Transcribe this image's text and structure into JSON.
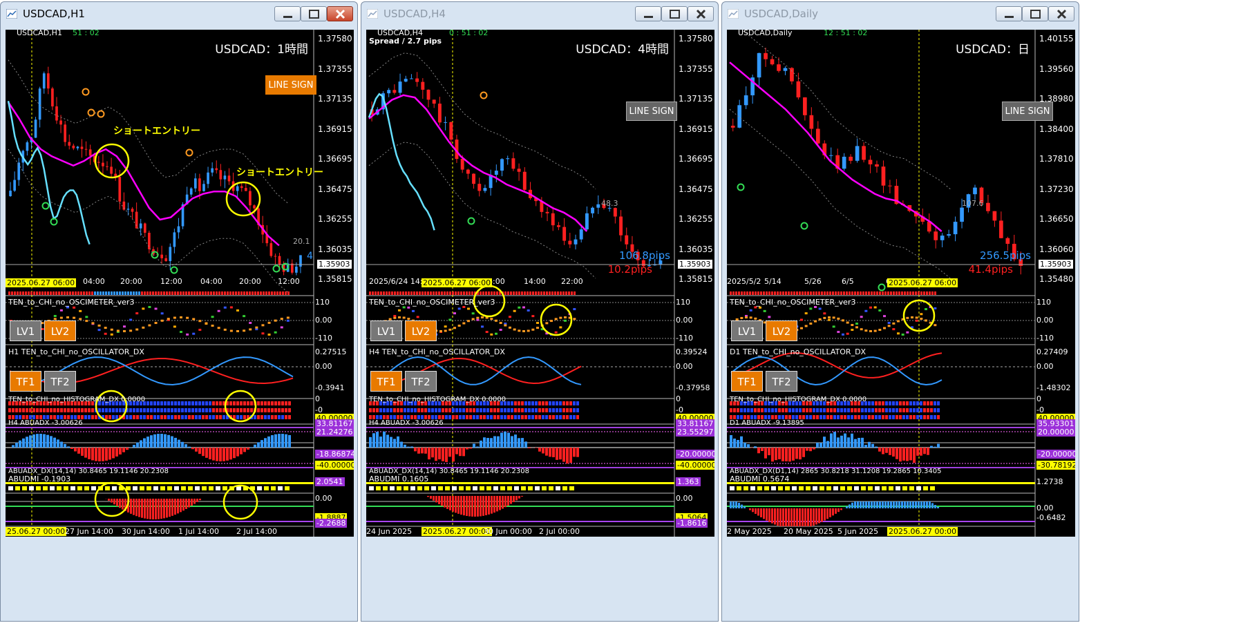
{
  "windows": [
    {
      "title": "USDCAD,H1",
      "symbol_label": "USDCAD,H1",
      "timer": "51 : 02",
      "spread": "",
      "big_title": "USDCAD：1時間",
      "line_sign": "LINE SIGN",
      "prices": [
        "1.37580",
        "1.37355",
        "1.37135",
        "1.36915",
        "1.36695",
        "1.36475",
        "1.36255",
        "1.36035",
        "1.35815"
      ],
      "current_price": "1.35903",
      "time_labels": [
        "04:00",
        "20:00",
        "12:00",
        "04:00",
        "20:00",
        "12:00"
      ],
      "date_marker": "2025.06.27 06:00",
      "annotations": [
        "ショートエントリー",
        "ショートエントリー"
      ],
      "right_value": "20.1",
      "right_value2": "4",
      "pips_up": "",
      "pips_down": "",
      "osc_name": "TEN_to_CHI_no_OSCIMETER_ver3",
      "osc_scale": [
        "110",
        "0.00",
        "-110"
      ],
      "lv1": "LV1",
      "lv2": "LV2",
      "dx_name": "H1 TEN_to_CHI_no_OSCILLATOR_DX",
      "dx_scale": [
        "0.27515",
        "0.00",
        "-0.3941"
      ],
      "tf1": "TF1",
      "tf2": "TF2",
      "hist_name": "TEN_to_CHI_no_HISTOGRAM_DX 0.0000",
      "hist_scale": [
        "0",
        "-0"
      ],
      "abuadx_name": "H4 ABUADX -3.00626",
      "abuadx_boxes": [
        "33.81167",
        "21.24276",
        "-18.86874",
        "-40.00000"
      ],
      "abuadx_top": "40.00000",
      "adx_strip": "ABUADX_DX(14,14) 30.8465 19.1146 20.2308",
      "abudmi_name": "ABUDMI -0.1903",
      "abudmi_boxes": [
        "2.0541",
        "0.00",
        "-1.8887",
        "-2.2688"
      ],
      "bottom_dates": [
        "25.06.27 00:00",
        "27 Jun 14:00",
        "30 Jun 14:00",
        "1 Jul 14:00",
        "2 Jul 14:00"
      ]
    },
    {
      "title": "USDCAD,H4",
      "symbol_label": "USDCAD,H4",
      "timer": "0 : 51 : 02",
      "spread": "Spread / 2.7 pips",
      "big_title": "USDCAD：4時間",
      "line_sign": "LINE SIGN",
      "prices": [
        "1.37580",
        "1.37355",
        "1.37135",
        "1.36915",
        "1.36695",
        "1.36475",
        "1.36255",
        "1.36035",
        "1.35815"
      ],
      "current_price": "1.35903",
      "time_labels": [
        "2025/6/24 14:00",
        "6:00",
        "14:00",
        "22:00"
      ],
      "date_marker": "2025.06.27 06:00",
      "annotations": [],
      "right_value": "48.3",
      "right_value2": "",
      "pips_up": "106.8pips",
      "pips_down": "10.2pips",
      "osc_name": "TEN_to_CHI_no_OSCIMETER_ver3",
      "osc_scale": [
        "110",
        "0.00",
        "-110"
      ],
      "lv1": "LV1",
      "lv2": "LV2",
      "dx_name": "H4 TEN_to_CHI_no_OSCILLATOR_DX",
      "dx_scale": [
        "0.39524",
        "0.00",
        "-0.37958"
      ],
      "tf1": "TF1",
      "tf2": "TF2",
      "hist_name": "TEN_to_CHI_no_HISTOGRAM_DX 0.0000",
      "hist_scale": [
        "0",
        "-0"
      ],
      "abuadx_name": "H4 ABUADX -3.00626",
      "abuadx_boxes": [
        "33.81167",
        "23.55297",
        "-20.00000",
        "-40.00000"
      ],
      "abuadx_top": "40.00000",
      "adx_strip": "ABUADX_DX(14,14) 30.8465 19.1146 20.2308",
      "abudmi_name": "ABUDMI 0.1605",
      "abudmi_boxes": [
        "1.363",
        "0.00",
        "-1.5064",
        "-1.8616"
      ],
      "bottom_dates": [
        "24 Jun 2025",
        "2025.06.27 00:00",
        "30 Jun 00:00",
        "2 Jul 00:00"
      ]
    },
    {
      "title": "USDCAD,Daily",
      "symbol_label": "USDCAD,Daily",
      "timer": "12 : 51 : 02",
      "spread": "",
      "big_title": "USDCAD：日",
      "line_sign": "LINE SIGN",
      "prices": [
        "1.40155",
        "1.39560",
        "1.38980",
        "1.38400",
        "1.37810",
        "1.37230",
        "1.36650",
        "1.36060",
        "1.35480"
      ],
      "current_price": "1.35903",
      "time_labels": [
        "2025/5/2",
        "5/14",
        "5/26",
        "6/5",
        "6"
      ],
      "date_marker": "2025.06.27 06:00",
      "annotations": [],
      "right_value": "107.6",
      "right_value2": "",
      "pips_up": "256.5pips",
      "pips_down": "41.4pips",
      "osc_name": "TEN_to_CHI_no_OSCIMETER_ver3",
      "osc_scale": [
        "110",
        "0.00",
        "-110"
      ],
      "lv1": "LV1",
      "lv2": "LV2",
      "dx_name": "D1 TEN_to_CHI_no_OSCILLATOR_DX",
      "dx_scale": [
        "0.27409",
        "0.00",
        "-1.48302"
      ],
      "tf1": "TF1",
      "tf2": "TF2",
      "hist_name": "TEN_to_CHI_no_HISTOGRAM_DX 0.0000",
      "hist_scale": [
        "0",
        "-0"
      ],
      "abuadx_name": "D1 ABUADX -9.13895",
      "abuadx_boxes": [
        "35.93301",
        "20.00000",
        "-20.00000",
        "-30.78192"
      ],
      "abuadx_top": "40.00000",
      "adx_strip": "ABUADX_DX(D1,14) 2865 30.8218 31.1208 19.2865 10.3405",
      "abudmi_name": "ABUDMI 0.5674",
      "abudmi_boxes": [
        "1.2738",
        "0.00",
        "-0.6482"
      ],
      "bottom_dates": [
        "2 May 2025",
        "20 May 2025",
        "5 Jun 2025",
        "2025.06.27 00:00"
      ]
    }
  ],
  "colors": {
    "bull": "#3399ff",
    "bear": "#ff2020",
    "ma": "#ff00ff",
    "orange": "#e87a00",
    "yellow": "#ffff00"
  }
}
